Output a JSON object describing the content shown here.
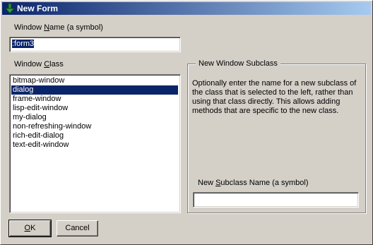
{
  "window": {
    "title": "New Form"
  },
  "name_field": {
    "label_pre": "Window ",
    "label_u": "N",
    "label_post": "ame (a symbol)",
    "value": ":form3"
  },
  "class_list": {
    "label_pre": "Window ",
    "label_u": "C",
    "label_post": "lass",
    "items": [
      "bitmap-window",
      "dialog",
      "frame-window",
      "lisp-edit-window",
      "my-dialog",
      "non-refreshing-window",
      "rich-edit-dialog",
      "text-edit-window"
    ],
    "selected_index": 1
  },
  "subclass_group": {
    "title": "New Window Subclass",
    "description": "Optionally enter the name for a new subclass of the class that is selected to the left, rather than using that class directly.  This allows adding methods that are specific to the new class.",
    "field_label_pre": "New ",
    "field_label_u": "S",
    "field_label_post": "ubclass Name (a symbol)",
    "value": ""
  },
  "buttons": {
    "ok_u": "O",
    "ok_post": "K",
    "cancel": "Cancel"
  },
  "colors": {
    "title_bar": "#0a246a",
    "selection": "#0a246a",
    "face": "#d4d0c8"
  },
  "icons": {
    "title": "app-down-arrow-icon"
  }
}
